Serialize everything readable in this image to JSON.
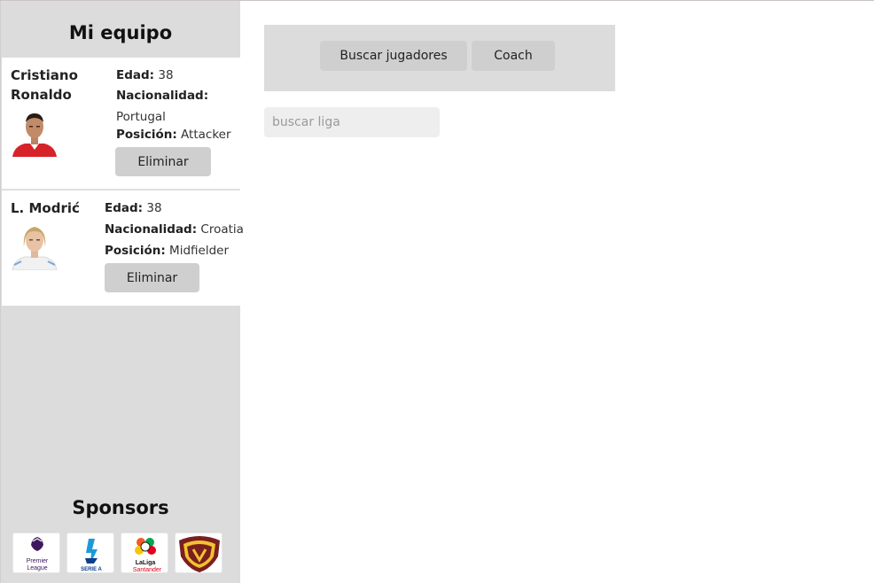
{
  "sidebar": {
    "title": "Mi equipo",
    "players": [
      {
        "name": "Cristiano Ronaldo",
        "age_label": "Edad:",
        "age": "38",
        "nationality_label": "Nacionalidad:",
        "nationality": "Portugal",
        "position_label": "Posición:",
        "position": "Attacker",
        "remove_label": "Eliminar",
        "kit_color": "#d6232a"
      },
      {
        "name": "L. Modrić",
        "age_label": "Edad:",
        "age": "38",
        "nationality_label": "Nacionalidad:",
        "nationality": "Croatia",
        "position_label": "Posición:",
        "position": "Midfielder",
        "remove_label": "Eliminar",
        "kit_color": "#f4f4f4"
      }
    ],
    "sponsors_title": "Sponsors",
    "sponsors": [
      {
        "icon": "premier-league-logo",
        "text_line1": "Premier",
        "text_line2": "League"
      },
      {
        "icon": "serie-a-logo",
        "text_line1": "SERIE A"
      },
      {
        "icon": "laliga-santander-logo",
        "text_line1": "LaLiga",
        "text_line2": "Santander"
      },
      {
        "icon": "venezuela-federation-crest"
      }
    ]
  },
  "nav": {
    "search_players": "Buscar jugadores",
    "coach": "Coach"
  },
  "search": {
    "placeholder": "buscar liga",
    "value": ""
  },
  "colors": {
    "sidebar_bg": "#dcdcdc",
    "button_bg": "#cfcfcf",
    "input_bg": "#eeeeee"
  }
}
